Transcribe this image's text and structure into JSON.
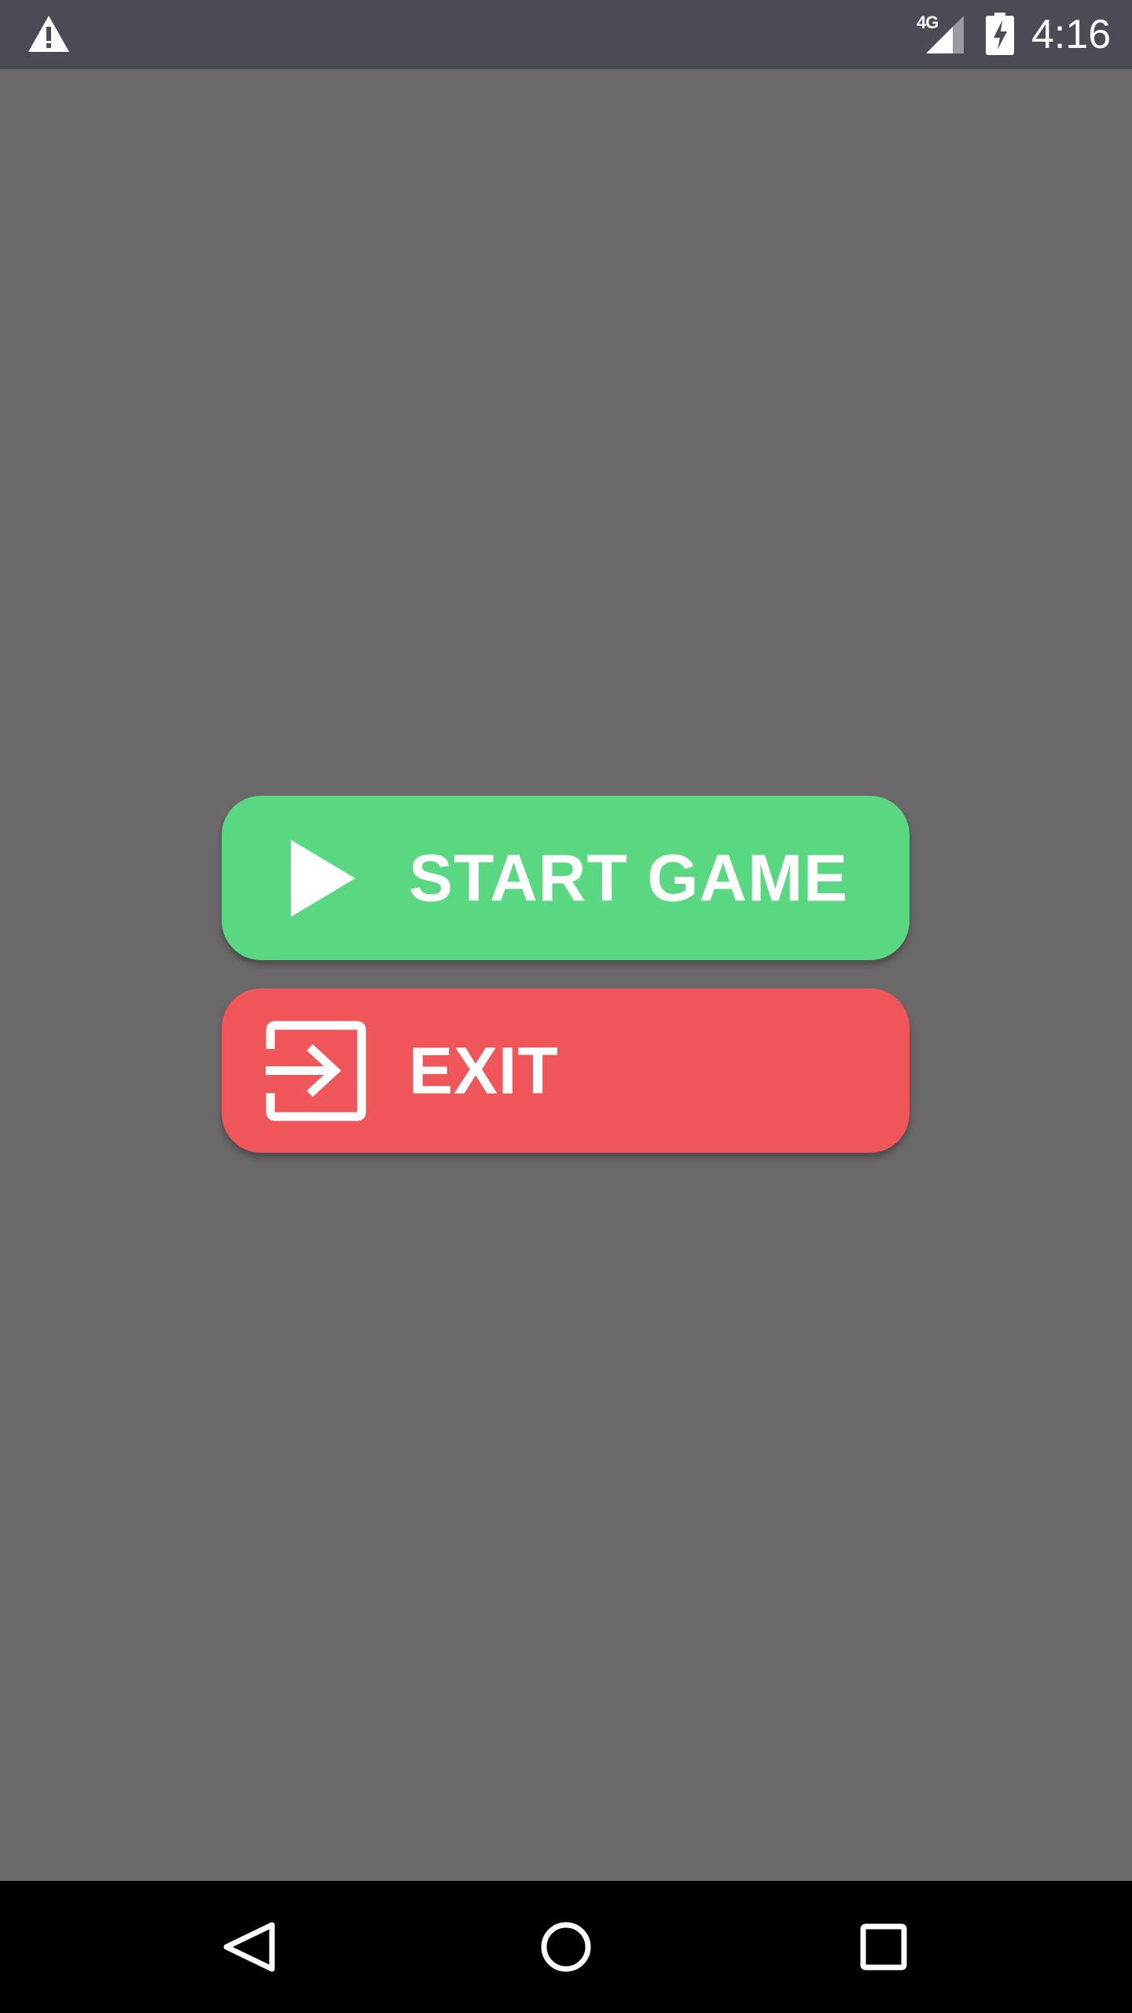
{
  "status_bar": {
    "network": "4G",
    "time": "4:16",
    "icons": [
      "warning-icon",
      "signal-icon",
      "battery-charging-icon"
    ]
  },
  "menu": {
    "start": {
      "label": "START GAME",
      "icon": "play-icon",
      "color": "#59d781"
    },
    "exit": {
      "label": "EXIT",
      "icon": "exit-icon",
      "color": "#ef565a"
    }
  },
  "nav_bar": {
    "icons": [
      "back-icon",
      "home-icon",
      "recents-icon"
    ]
  },
  "colors": {
    "background": "#6a6869",
    "status_bar": "#4a4b54",
    "nav_bar": "#000000"
  }
}
